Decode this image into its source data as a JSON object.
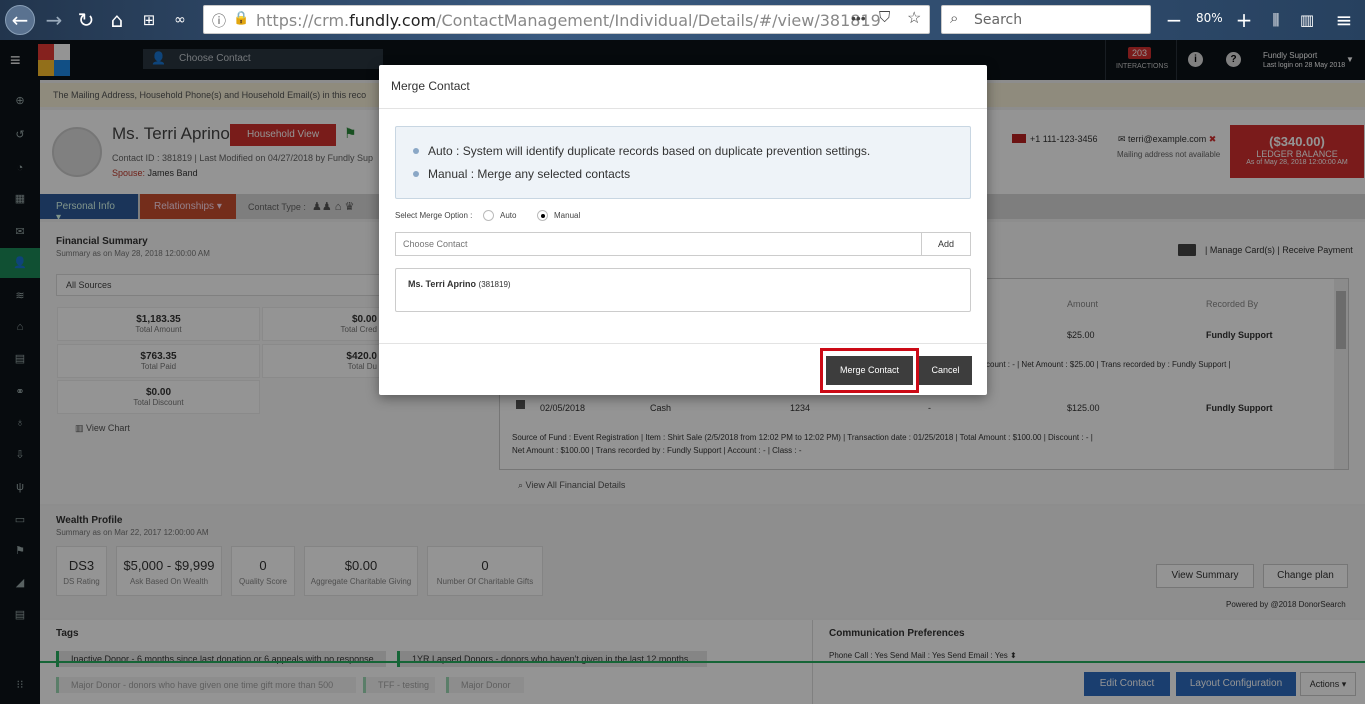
{
  "browser": {
    "url_prefix": "https://crm.",
    "url_domain": "fundly.com",
    "url_path": "/ContactManagement/Individual/Details/#/view/381819",
    "search_placeholder": "Search",
    "zoom": "80%",
    "more_label": "•••"
  },
  "header": {
    "choose_contact": "Choose Contact",
    "interactions_count": "203",
    "interactions_label": "INTERACTIONS",
    "user_name": "Fundly Support",
    "last_login": "Last login on 28 May 2018"
  },
  "contact": {
    "notice": "The Mailing Address, Household Phone(s) and Household Email(s) in this reco",
    "name": "Ms. Terri Aprino",
    "id_line": "Contact ID : 381819  |  Last Modified on 04/27/2018 by Fundly Sup",
    "spouse_label": "Spouse:",
    "spouse_name": "James Band",
    "household_btn": "Household View",
    "phone": "+1 111-123-3456",
    "email": "terri@example.com",
    "mailing": "Mailing address not available",
    "ledger_amount": "($340.00)",
    "ledger_label": "LEDGER BALANCE",
    "ledger_date": "As of May 28, 2018 12:00:00 AM"
  },
  "tabs": {
    "personal": "Personal Info ▾",
    "relationships": "Relationships ▾",
    "contact_type": "Contact Type :"
  },
  "financial": {
    "title": "Financial Summary",
    "subtitle": "Summary as on May 28, 2018 12:00:00 AM",
    "sources": "All Sources",
    "cards": [
      {
        "value": "$1,183.35",
        "label": "Total Amount"
      },
      {
        "value": "$0.00",
        "label": "Total Cred"
      },
      {
        "value": "$763.35",
        "label": "Total Paid"
      },
      {
        "value": "$420.0",
        "label": "Total Du"
      },
      {
        "value": "$0.00",
        "label": "Total Discount"
      }
    ],
    "view_chart": "View Chart",
    "manage_links": "| Manage Card(s)  |  Receive Payment",
    "col_amount": "Amount",
    "col_recorded": "Recorded By",
    "row1_amount": "$25.00",
    "row1_recorded": "Fundly Support",
    "row1_detail": "count : -   |   Net Amount : $25.00   |   Trans recorded by : Fundly Support   |",
    "row2_date": "02/05/2018",
    "row2_type": "Cash",
    "row2_check": "1234",
    "row2_dash": "-",
    "row2_amount": "$125.00",
    "row2_recorded": "Fundly Support",
    "row2_detail1": "Source of Fund : Event Registration   |   Item : Shirt Sale (2/5/2018 from 12:02 PM to 12:02 PM)   |   Transaction date : 01/25/2018   |   Total Amount : $100.00   |   Discount : -   |",
    "row2_detail2": "Net Amount : $100.00   |   Trans recorded by : Fundly Support   |   Account : -   |   Class : -",
    "view_all": "View All Financial Details"
  },
  "wealth": {
    "title": "Wealth Profile",
    "subtitle": "Summary as on Mar 22, 2017 12:00:00 AM",
    "cards": [
      {
        "value": "DS3",
        "label": "DS Rating"
      },
      {
        "value": "$5,000 - $9,999",
        "label": "Ask Based On Wealth"
      },
      {
        "value": "0",
        "label": "Quality Score"
      },
      {
        "value": "$0.00",
        "label": "Aggregate Charitable Giving"
      },
      {
        "value": "0",
        "label": "Number Of Charitable Gifts"
      }
    ],
    "view_summary": "View Summary",
    "change_plan": "Change plan",
    "powered": "Powered by @2018 DonorSearch"
  },
  "tags": {
    "title": "Tags",
    "items": [
      "Inactive Donor - 6 months since last donation or 6 appeals with no response",
      "1YR Lapsed Donors - donors who haven't given in the last 12 months",
      "Major Donor - donors who have given one time gift more than 500",
      "TFF - testing",
      "Major Donor"
    ]
  },
  "comm": {
    "title": "Communication Preferences",
    "line": "Phone Call : Yes    Send Mail : Yes    Send Email : Yes ⬍"
  },
  "footer": {
    "edit": "Edit Contact",
    "layout": "Layout Configuration",
    "actions": "Actions ▾"
  },
  "modal": {
    "title": "Merge Contact",
    "bullet_auto": "Auto : System will identify duplicate records based on duplicate prevention settings.",
    "bullet_manual": "Manual : Merge any selected contacts",
    "option_label": "Select Merge Option :",
    "auto": "Auto",
    "manual": "Manual",
    "input_placeholder": "Choose Contact",
    "add": "Add",
    "selected_name": "Ms. Terri Aprino",
    "selected_id": "(381819)",
    "merge_btn": "Merge Contact",
    "cancel_btn": "Cancel"
  },
  "colors": {
    "accent_red": "#cc0a16",
    "nav_blue": "#2d5a9a",
    "dark_button": "#3d3d3d"
  }
}
